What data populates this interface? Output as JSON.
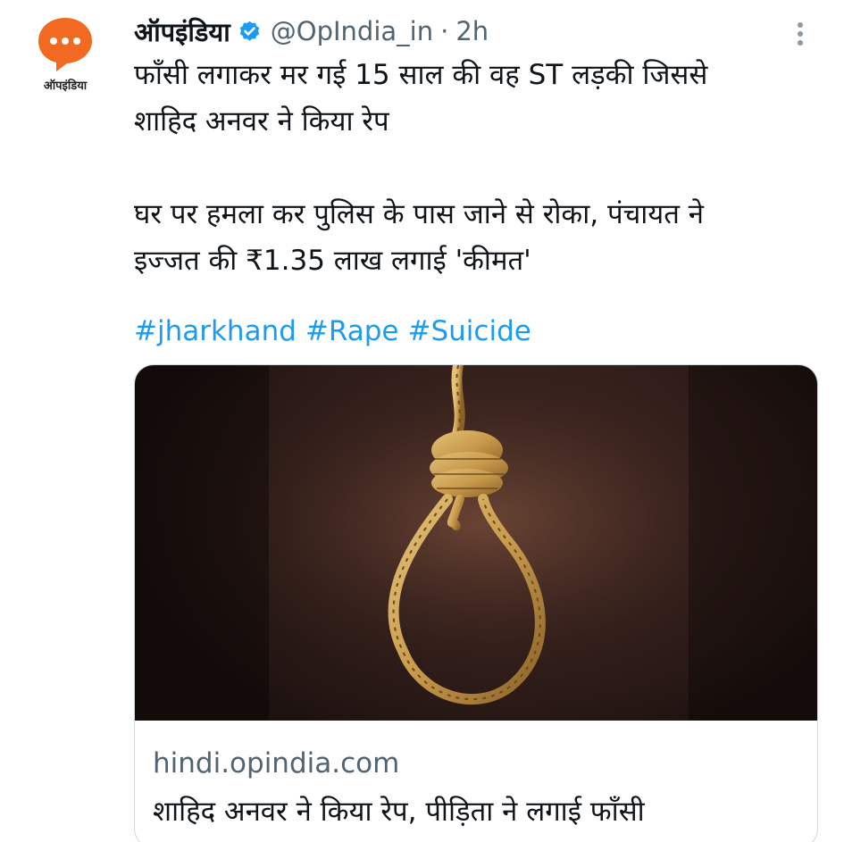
{
  "account": {
    "display_name": "ऑपइंडिया",
    "handle": "@OpIndia_in",
    "separator": "·",
    "time": "2h",
    "avatar_caption": "ऑपइंडिया",
    "avatar_color": "#f26a21"
  },
  "tweet": {
    "line1": "फाँसी लगाकर मर गई 15 साल की वह ST लड़की जिससे",
    "line2": "शाहिद अनवर ने किया रेप",
    "line3": "घर पर हमला कर पुलिस के पास जाने से रोका, पंचायत ने",
    "line4": "इज्जत की ₹1.35 लाख लगाई 'कीमत'",
    "hashtags": [
      "#jharkhand",
      "#Rape",
      "#Suicide"
    ]
  },
  "card": {
    "domain": "hindi.opindia.com",
    "title": "शाहिद अनवर ने किया रेप, पीड़िता ने लगाई फाँसी",
    "image_icon": "noose-image"
  },
  "colors": {
    "link": "#1d9bf0",
    "secondary_text": "#536471",
    "verified": "#1d9bf0"
  },
  "icons": {
    "verified": "verified-badge-icon",
    "more": "more-options-icon"
  }
}
